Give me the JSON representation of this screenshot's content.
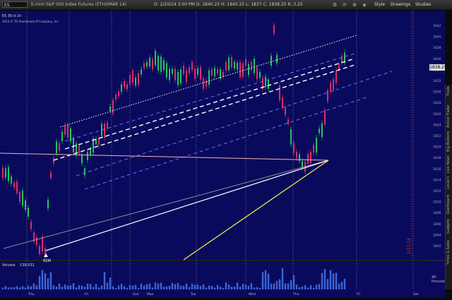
{
  "toolbar": {
    "symbol": "ES",
    "description": "E-mini S&P 500 Index Futures (ETH)(MAR 14)",
    "ohlc_label": "D: 2/20/14 3:00 PM  O: 1840.25  H: 1840.25  L: 1837  C: 1838.25  R: 3.25",
    "buttons": [
      "Style",
      "Drawings",
      "Studies"
    ],
    "icons": [
      "settings-icon",
      "refresh-icon",
      "zoom-icon",
      "link-icon"
    ]
  },
  "info_bar": {
    "left_label": "ES 30 d 1h",
    "copyright": "2013 © TD Ameritrade IP Company, Inc."
  },
  "chart": {
    "current_price": "1838.25",
    "price_axis": [
      "1842",
      "1840",
      "1838",
      "1836",
      "1834",
      "1832",
      "1830",
      "1828",
      "1826",
      "1824",
      "1822",
      "1820",
      "1818",
      "1816",
      "1814",
      "1812",
      "1810",
      "1808",
      "1806",
      "1804",
      "1802"
    ],
    "day_labels": [
      "Thu",
      "Fri",
      "Sun",
      "Mon",
      "Tue",
      "Wed",
      "Thu",
      "Fri",
      "Sat"
    ],
    "low_marker": "R2M",
    "vertical_text": "2/21/14",
    "volume_label": "Volume",
    "volume_value": "139,031",
    "volume_axis": "40 thousand",
    "colors": {
      "background": "#0a0a5c",
      "up": "#22c55e",
      "down": "#d92c6a",
      "trend_white": "#ffffff",
      "trend_blue": "#6b6bff",
      "trend_yellow": "#f5f542",
      "trend_pink": "#f2b0b0"
    }
  },
  "chart_data": {
    "type": "line",
    "title": "",
    "ylim": [
      1800,
      1846
    ],
    "annotations": [
      "R2M"
    ]
  },
  "side_tabs": [
    "Trade",
    "Active Trader",
    "Big Buttons",
    "Live News",
    "Level II",
    "Dashboard",
    "Gadgets",
    "Times & Sales"
  ]
}
